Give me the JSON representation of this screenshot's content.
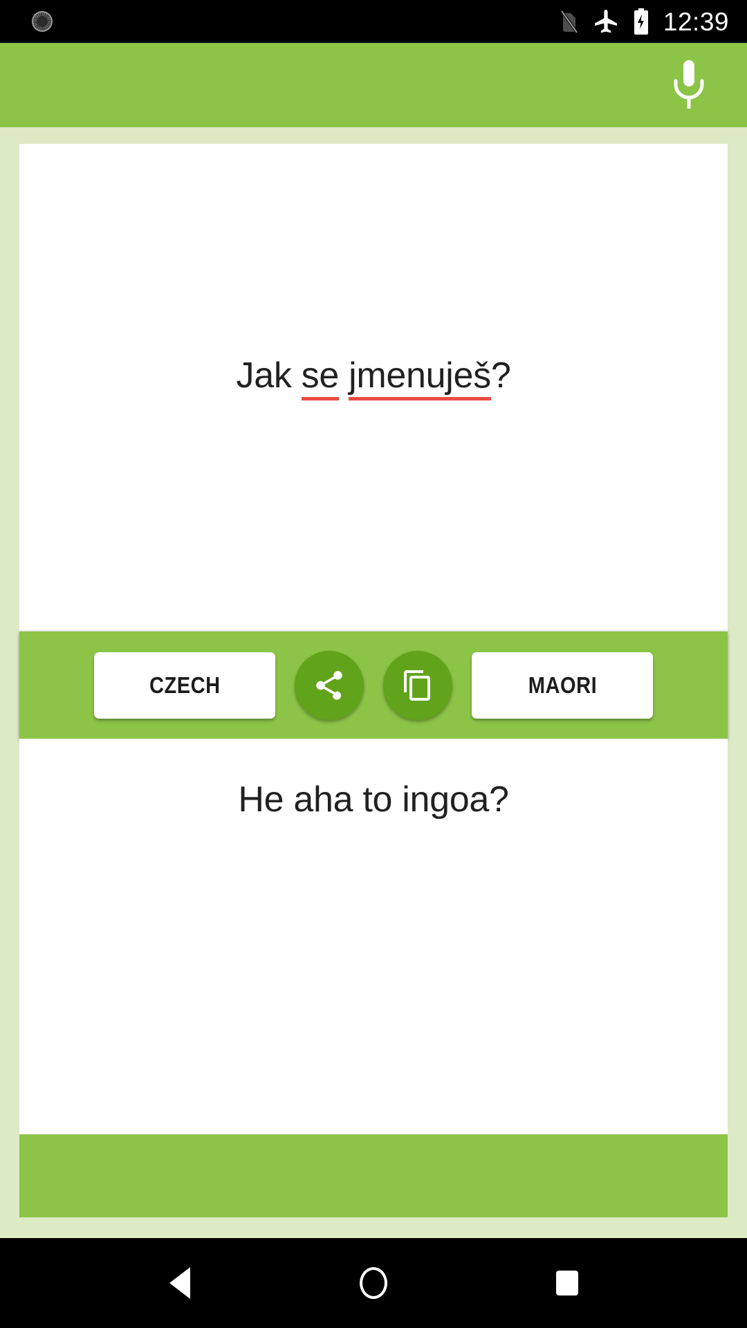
{
  "status_bar": {
    "icons": [
      "alarm-clock-icon",
      "no-sim-icon",
      "airplane-mode-icon",
      "battery-charging-icon"
    ],
    "time": "12:39",
    "background_color": "#000000",
    "foreground_color": "#ffffff"
  },
  "app_bar": {
    "background_color": "#8cc447",
    "mic_icon": "microphone-icon"
  },
  "source": {
    "text_parts": [
      {
        "text": "Jak ",
        "misspelled": false
      },
      {
        "text": "se",
        "misspelled": true
      },
      {
        "text": " ",
        "misspelled": false
      },
      {
        "text": "jmenuješ",
        "misspelled": true
      },
      {
        "text": "?",
        "misspelled": false
      }
    ],
    "full_text": "Jak se jmenuješ?",
    "spellcheck_underline_color": "#ea4b41",
    "background_color": "#ffffff"
  },
  "toolbar": {
    "background_color": "#8cc447",
    "source_language_label": "CZECH",
    "target_language_label": "MAORI",
    "share_icon": "share-icon",
    "copy_icon": "copy-icon",
    "circle_button_color": "#61a31a"
  },
  "target": {
    "text": "He aha to ingoa?",
    "background_color": "#ffffff"
  },
  "footer": {
    "background_color": "#8cc447"
  },
  "nav_bar": {
    "background_color": "#000000",
    "back_icon": "back-triangle-icon",
    "home_icon": "home-circle-icon",
    "recents_icon": "recents-square-icon"
  },
  "page_background_color": "#dceac6"
}
